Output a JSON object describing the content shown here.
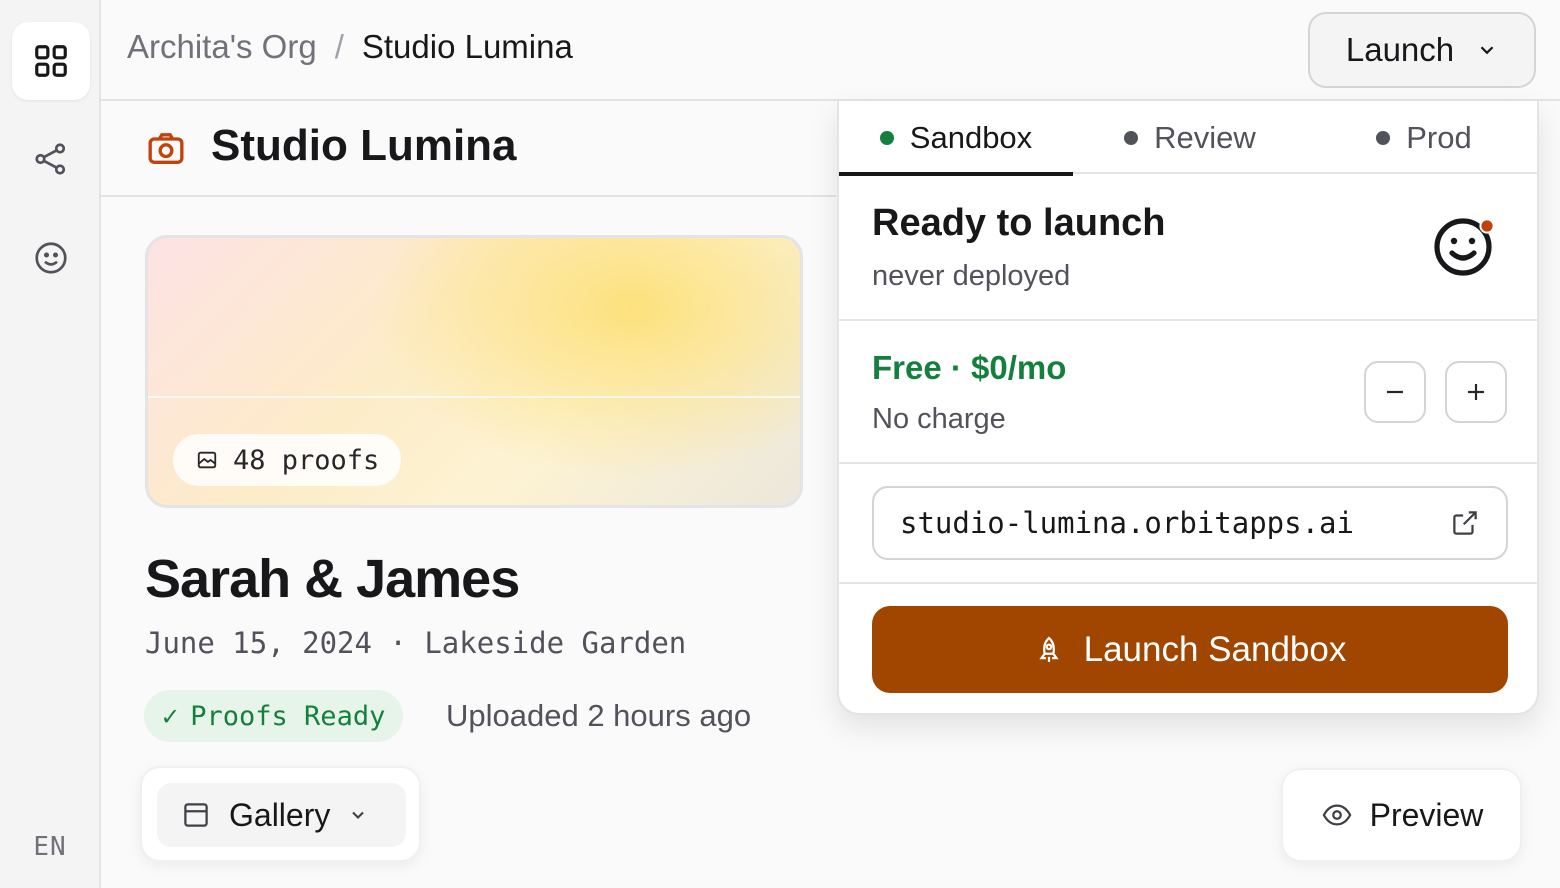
{
  "rail": {
    "items": [
      {
        "icon": "grid-icon",
        "active": true
      },
      {
        "icon": "share-icon",
        "active": false
      },
      {
        "icon": "smiley-icon",
        "active": false
      }
    ],
    "language": "EN"
  },
  "header": {
    "org": "Archita's Org",
    "separator": "/",
    "project": "Studio Lumina",
    "launch_label": "Launch"
  },
  "page": {
    "title": "Studio Lumina",
    "icon": "camera-icon",
    "accent": "#c2410c"
  },
  "event": {
    "proofs_count": "48 proofs",
    "names": "Sarah & James",
    "meta": "June 15, 2024 · Lakeside Garden",
    "status": "Proofs Ready",
    "uploaded": "Uploaded 2 hours ago"
  },
  "toolbar": {
    "gallery_label": "Gallery",
    "preview_label": "Preview"
  },
  "launch_panel": {
    "tabs": [
      {
        "label": "Sandbox",
        "active": true
      },
      {
        "label": "Review",
        "active": false
      },
      {
        "label": "Prod",
        "active": false
      }
    ],
    "status_title": "Ready to launch",
    "status_sub": "never deployed",
    "plan_name": "Free · $0/mo",
    "plan_sub": "No charge",
    "url": "studio-lumina.orbitapps.ai",
    "launch_button": "Launch Sandbox",
    "button_color": "#a14600",
    "success_color": "#15803d"
  }
}
